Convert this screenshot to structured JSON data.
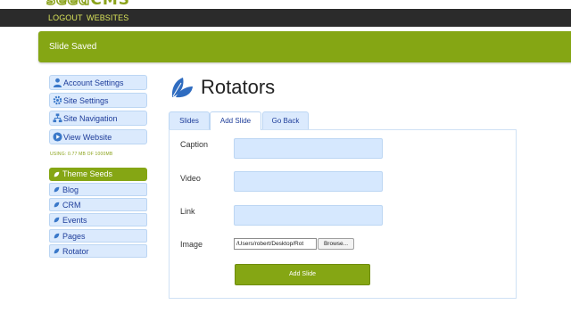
{
  "brand": {
    "logo_prefix": "seed",
    "logo_suffix": "CMS",
    "accent_color": "#85a614",
    "link_color": "#1e3d9a"
  },
  "topbar": {
    "logout": "LOGOUT",
    "websites": "WEBSITES"
  },
  "banner": {
    "message": "Slide Saved"
  },
  "sidebar": {
    "items": [
      {
        "label": "Account Settings",
        "icon": "user-icon"
      },
      {
        "label": "Site Settings",
        "icon": "gear-icon"
      },
      {
        "label": "Site Navigation",
        "icon": "sitemap-icon"
      },
      {
        "label": "View Website",
        "icon": "play-icon"
      }
    ],
    "usage": "USING: 0.77 MB OF 1000MB",
    "seeds_header": "Theme Seeds",
    "seeds": [
      {
        "label": "Blog"
      },
      {
        "label": "CRM"
      },
      {
        "label": "Events"
      },
      {
        "label": "Pages"
      },
      {
        "label": "Rotator"
      }
    ]
  },
  "main": {
    "title": "Rotators",
    "title_icon": "seed-leaf-icon",
    "tabs": [
      {
        "label": "Slides",
        "active": false
      },
      {
        "label": "Add Slide",
        "active": true
      },
      {
        "label": "Go Back",
        "active": false
      }
    ],
    "form": {
      "caption_label": "Caption",
      "caption_value": "",
      "video_label": "Video",
      "video_value": "",
      "link_label": "Link",
      "link_value": "",
      "image_label": "Image",
      "image_value": "/Users/robert/Desktop/Rot",
      "browse_label": "Browse...",
      "submit_label": "Add Slide"
    }
  }
}
